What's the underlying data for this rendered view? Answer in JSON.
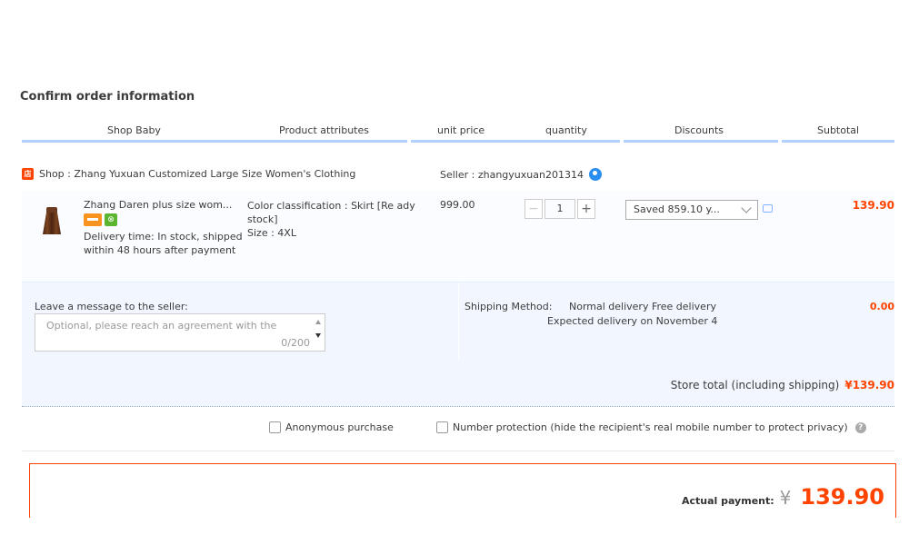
{
  "page": {
    "title": "Confirm order information"
  },
  "columns": [
    "Shop Baby",
    "Product attributes",
    "unit price",
    "quantity",
    "Discounts",
    "Subtotal"
  ],
  "shop": {
    "icon": "shop-icon",
    "label": "Shop :  Zhang Yuxuan Customized Large Size Women's Clothing",
    "seller": "Seller :  zhangyuxuan201314"
  },
  "item": {
    "title": "Zhang Daren plus size wom...",
    "delivery": "Delivery time: In stock, shipped within 48 hours after payment",
    "attr_color": "Color classification : Skirt [Re ady stock]",
    "attr_size": "Size : 4XL",
    "unit_price": "999.00",
    "quantity": "1",
    "minus": "−",
    "plus": "+",
    "discount": "Saved 859.10 y...",
    "subtotal": "139.90"
  },
  "message": {
    "label": "Leave a message to the seller:",
    "placeholder": "Optional, please reach an agreement with the",
    "count": "0/200"
  },
  "shipping": {
    "label": "Shipping Method:",
    "method": "Normal delivery Free delivery",
    "expected": "Expected delivery on November 4",
    "fee": "0.00"
  },
  "store_total": {
    "label": "Store total (including shipping)",
    "amount": "¥139.90"
  },
  "options": {
    "anonymous": "Anonymous purchase",
    "number_protection": "Number protection (hide the recipient's real mobile number to protect privacy)"
  },
  "payment": {
    "label": "Actual payment:",
    "currency": "¥",
    "amount": "139.90"
  },
  "colors": {
    "accent": "#ff4400",
    "header_line": "#b2d1ff",
    "panel_bg": "#f2f7ff"
  }
}
